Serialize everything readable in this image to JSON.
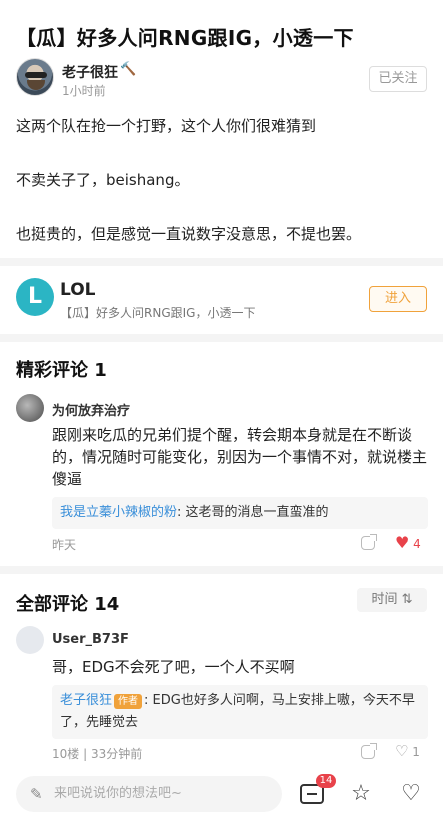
{
  "post": {
    "title": "【瓜】好多人问RNG跟IG，小透一下",
    "author": "老子很狂",
    "author_icon": "hammer-icon",
    "time": "1小时前",
    "follow_label": "已关注",
    "paragraphs": [
      "这两个队在抢一个打野，这个人你们很难猜到",
      "不卖关子了，beishang。",
      "也挺贵的，但是感觉一直说数字没意思，不提也罢。"
    ]
  },
  "forum": {
    "logo_text": "L",
    "name": "LOL",
    "subtitle": "【瓜】好多人问RNG跟IG，小透一下",
    "join_label": "进入"
  },
  "featured": {
    "title": "精彩评论 1",
    "comment": {
      "user": "为何放弃治疗",
      "text": "跟刚来吃瓜的兄弟们提个醒，转会期本身就是在不断谈的，情况随时可能变化，别因为一个事情不对，就说楼主傻逼",
      "reply_user": "我是立蓁小辣椒的粉",
      "reply_text": ": 这老哥的消息一直蛮准的",
      "time": "昨天",
      "likes": "4"
    }
  },
  "all_comments": {
    "title": "全部评论 14",
    "sort_label": "时间 ⇅",
    "comment": {
      "user": "User_B73F",
      "text": "哥，EDG不会死了吧，一个人不买啊",
      "reply_user": "老子很狂",
      "reply_tag": "作者",
      "reply_text": ": EDG也好多人问啊，马上安排上嗷，今天不早了，先睡觉去",
      "meta": "10楼 | 33分钟前",
      "likes": "1"
    }
  },
  "bottom_bar": {
    "placeholder": "来吧说说你的想法吧~",
    "comment_count": "14",
    "icons": [
      "pen-icon",
      "comment-icon",
      "star-icon",
      "heart-icon"
    ]
  },
  "colors": {
    "accent": "#f0a23b",
    "link": "#3a8fd9",
    "like": "#e8424a",
    "lol_brand": "#2bb5c4"
  }
}
